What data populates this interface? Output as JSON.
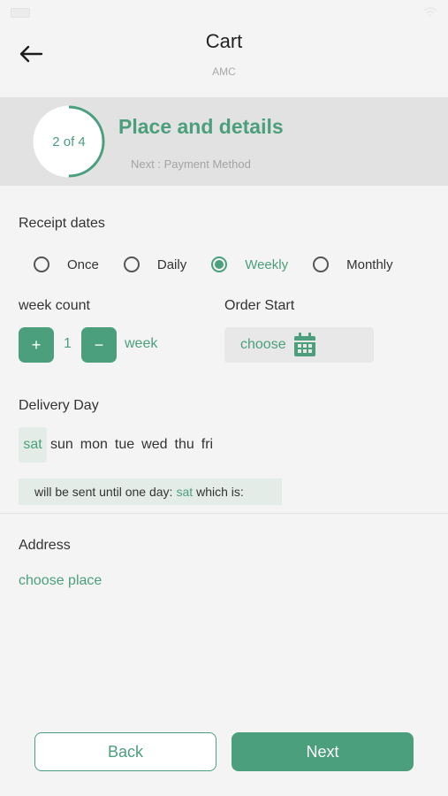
{
  "header": {
    "title": "Cart",
    "subtitle": "AMC",
    "back_icon": "arrow-left-icon"
  },
  "step": {
    "indicator": "2 of 4",
    "progress": 0.5,
    "title": "Place and details",
    "next": "Next : Payment Method"
  },
  "receipt": {
    "label": "Receipt dates",
    "options": [
      {
        "label": "Once",
        "selected": false
      },
      {
        "label": "Daily",
        "selected": false
      },
      {
        "label": "Weekly",
        "selected": true
      },
      {
        "label": "Monthly",
        "selected": false
      }
    ]
  },
  "week_count": {
    "label": "week count",
    "plus": "+",
    "value": "1",
    "minus": "−",
    "unit": "week"
  },
  "order_start": {
    "label": "Order Start",
    "choose": "choose",
    "icon": "calendar-icon"
  },
  "delivery": {
    "label": "Delivery Day",
    "days": [
      "sat",
      "sun",
      "mon",
      "tue",
      "wed",
      "thu",
      "fri"
    ],
    "selected_day": "sat",
    "info_prefix": "will be sent until one day:",
    "info_day": "sat",
    "info_suffix": "which is:"
  },
  "address": {
    "label": "Address",
    "choose_place": "choose place"
  },
  "footer": {
    "back": "Back",
    "next": "Next"
  },
  "colors": {
    "accent": "#4b9f7d",
    "banner": "#e2e2e2",
    "background": "#f4f4f4"
  }
}
